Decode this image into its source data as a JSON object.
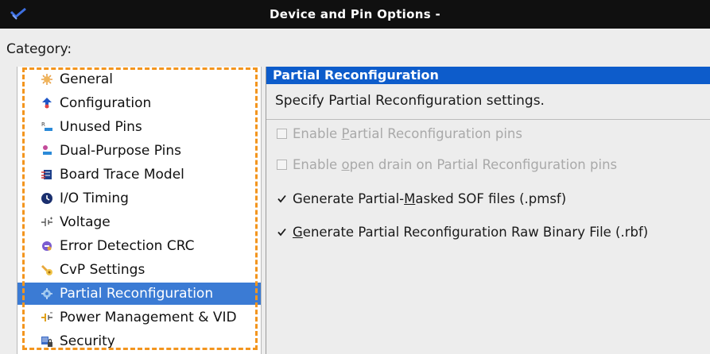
{
  "window": {
    "title": "Device and Pin Options -"
  },
  "category_label": "Category:",
  "categories": [
    {
      "label": "General",
      "icon": "general-icon",
      "selected": false
    },
    {
      "label": "Configuration",
      "icon": "configuration-icon",
      "selected": false
    },
    {
      "label": "Unused Pins",
      "icon": "unused-pins-icon",
      "selected": false
    },
    {
      "label": "Dual-Purpose Pins",
      "icon": "dual-purpose-pins-icon",
      "selected": false
    },
    {
      "label": "Board Trace Model",
      "icon": "board-trace-model-icon",
      "selected": false
    },
    {
      "label": "I/O Timing",
      "icon": "io-timing-icon",
      "selected": false
    },
    {
      "label": "Voltage",
      "icon": "voltage-icon",
      "selected": false
    },
    {
      "label": "Error Detection CRC",
      "icon": "error-detection-crc-icon",
      "selected": false
    },
    {
      "label": "CvP Settings",
      "icon": "cvp-settings-icon",
      "selected": false
    },
    {
      "label": "Partial Reconfiguration",
      "icon": "partial-reconfiguration-icon",
      "selected": true
    },
    {
      "label": "Power Management & VID",
      "icon": "power-management-icon",
      "selected": false
    },
    {
      "label": "Security",
      "icon": "security-icon",
      "selected": false
    }
  ],
  "panel": {
    "header": "Partial Reconfiguration",
    "description": "Specify Partial Reconfiguration settings.",
    "options": [
      {
        "pre": "Enable ",
        "mnemonic": "P",
        "post": "artial Reconfiguration pins",
        "checked": false,
        "enabled": false
      },
      {
        "pre": "Enable ",
        "mnemonic": "o",
        "post": "pen drain on Partial Reconfiguration pins",
        "checked": false,
        "enabled": false
      },
      {
        "pre": "Generate Partial-",
        "mnemonic": "M",
        "post": "asked SOF files (.pmsf)",
        "checked": true,
        "enabled": true
      },
      {
        "pre": "",
        "mnemonic": "G",
        "post": "enerate Partial Reconfiguration Raw Binary File (.rbf)",
        "checked": true,
        "enabled": true
      }
    ]
  },
  "colors": {
    "selection": "#3b7bd4",
    "header_bar": "#0d5ccb",
    "highlight_dashes": "#f3951e",
    "titlebar": "#101010"
  }
}
